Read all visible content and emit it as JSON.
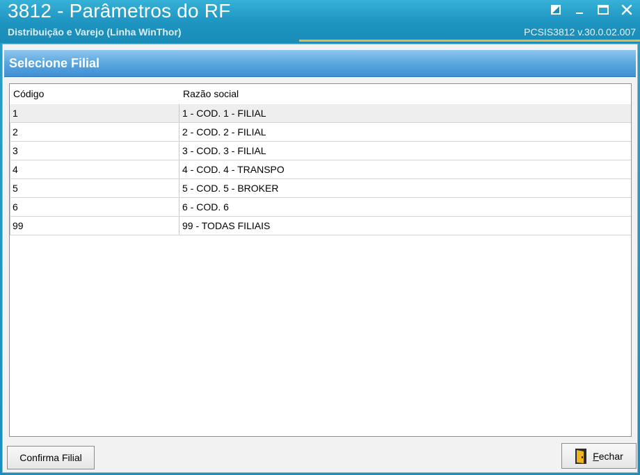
{
  "window": {
    "title": "3812 - Parâmetros do RF",
    "subtitle": "Distribuição e Varejo (Linha WinThor)",
    "version": "PCSIS3812  v.30.0.02.007",
    "accent_color": "#1b8fbb"
  },
  "window_controls": [
    {
      "name": "restore-icon"
    },
    {
      "name": "minimize-icon"
    },
    {
      "name": "maximize-icon"
    },
    {
      "name": "close-icon"
    }
  ],
  "panel": {
    "title": "Selecione Filial",
    "header_color": "#4a9ad8"
  },
  "grid": {
    "columns": [
      "Código",
      "Razão social"
    ],
    "rows": [
      {
        "codigo": "1",
        "razao": "1 - COD. 1 - FILIAL"
      },
      {
        "codigo": "2",
        "razao": "2 - COD. 2 - FILIAL"
      },
      {
        "codigo": "3",
        "razao": "3 - COD. 3 - FILIAL"
      },
      {
        "codigo": "4",
        "razao": "4 - COD. 4 - TRANSPO"
      },
      {
        "codigo": "5",
        "razao": "5 - COD. 5 - BROKER"
      },
      {
        "codigo": "6",
        "razao": "6 - COD. 6"
      },
      {
        "codigo": "99",
        "razao": "99 - TODAS FILIAIS"
      }
    ],
    "selected_row": 0
  },
  "buttons": {
    "confirm_label": "Confirma Filial",
    "close_label": "Fechar",
    "close_icon": "door-exit-icon"
  }
}
